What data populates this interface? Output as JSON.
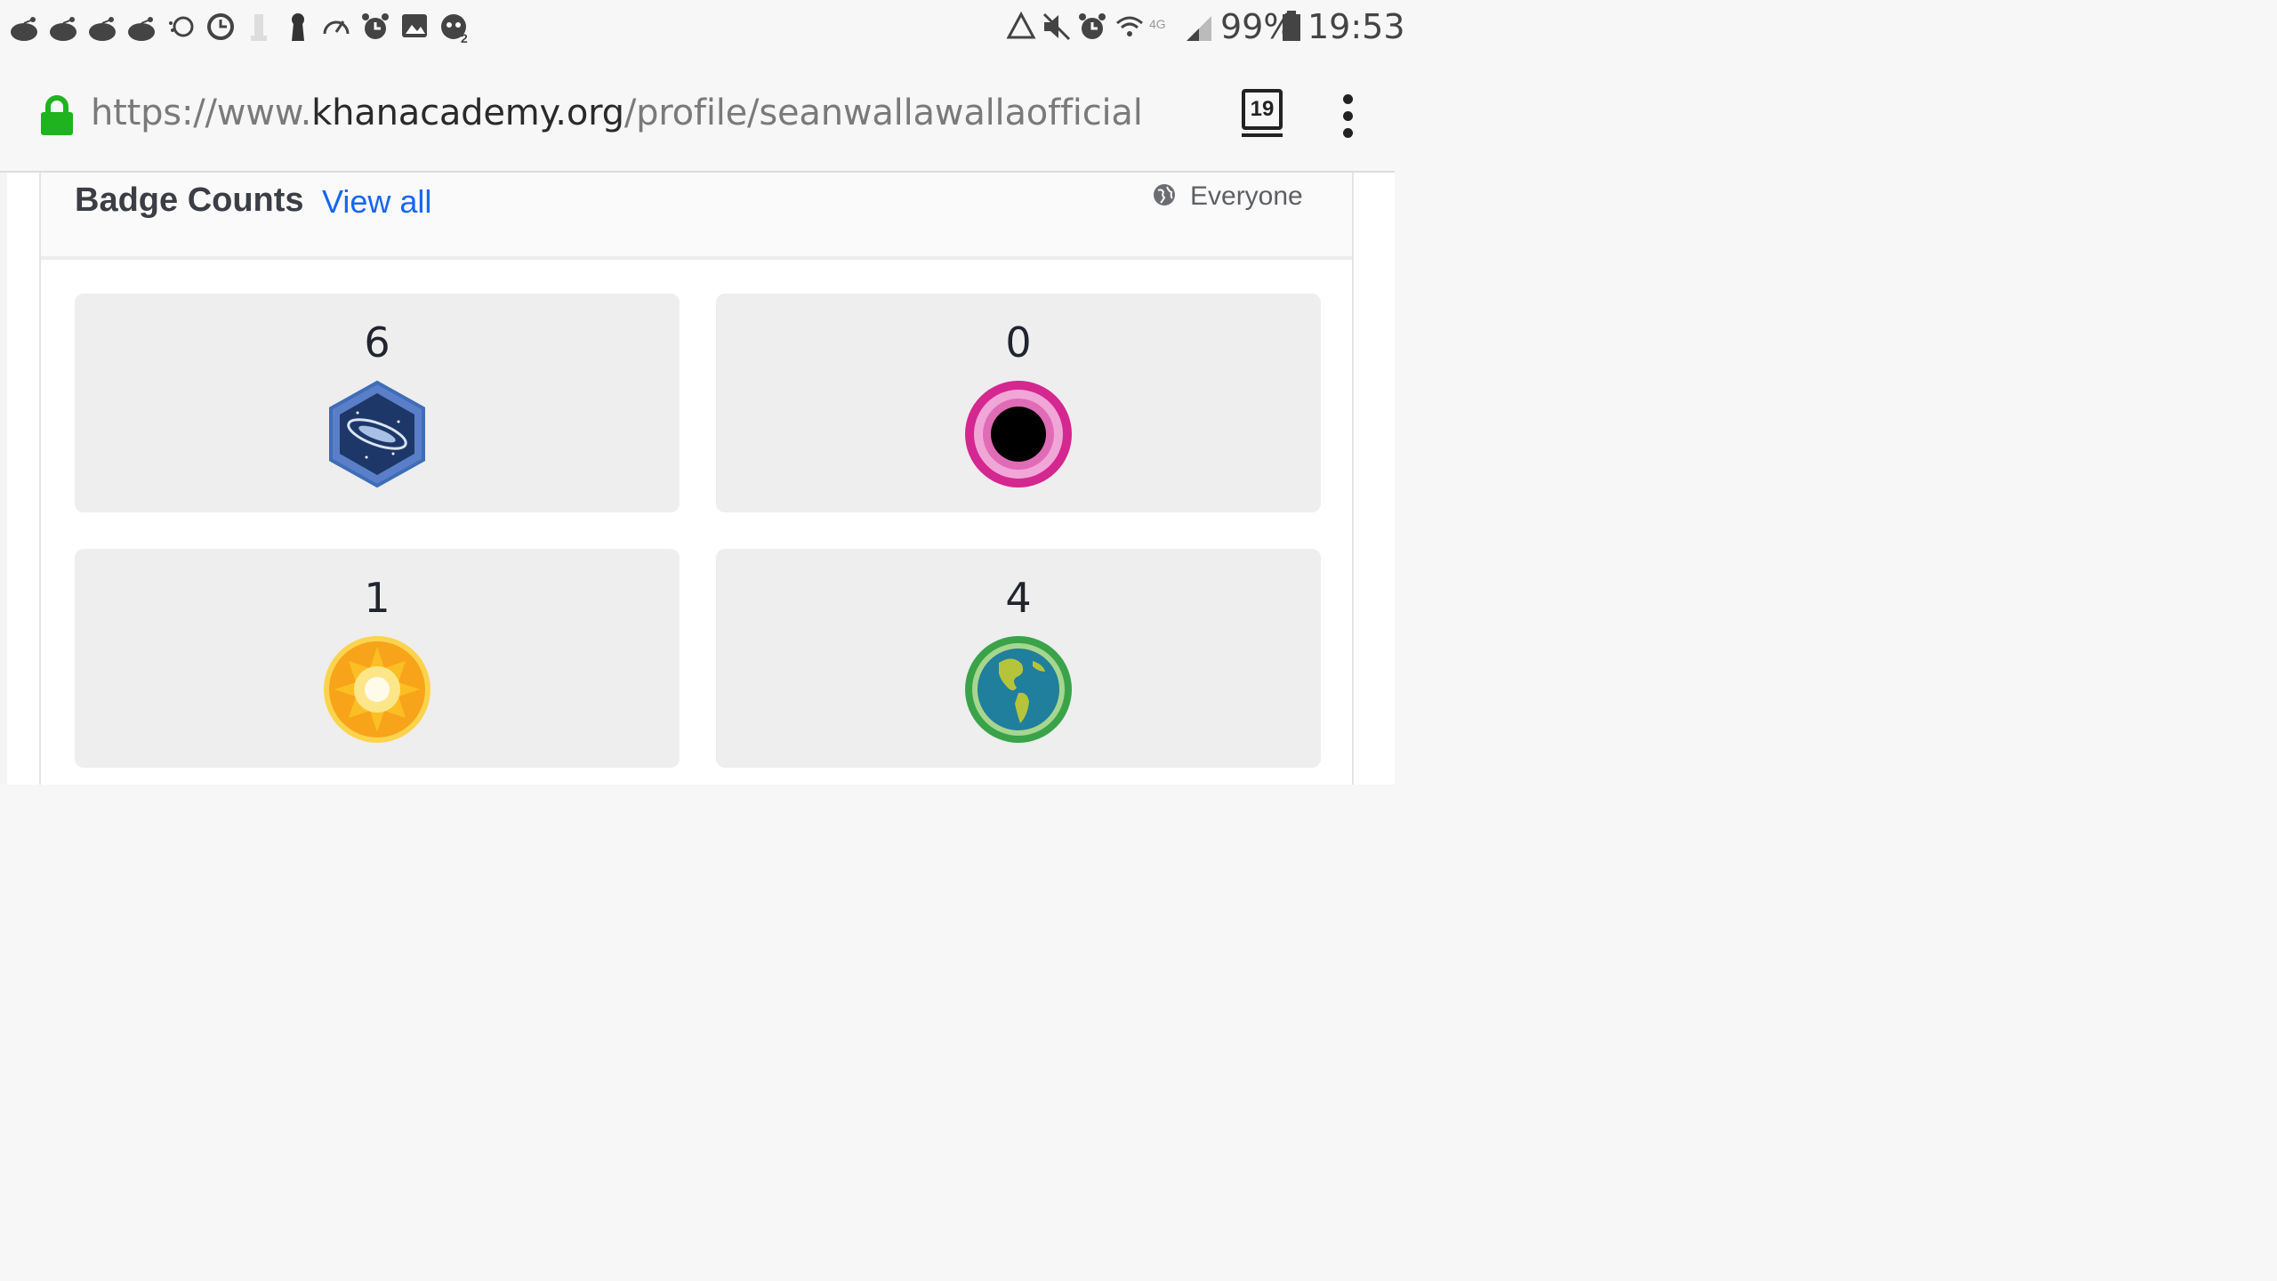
{
  "status_bar": {
    "battery_percent": "99%",
    "time": "19:53",
    "left_icons": [
      "reddit-icon",
      "reddit-icon",
      "reddit-icon",
      "reddit-icon",
      "sync-icon",
      "clock-icon",
      "chess-icon",
      "keyhole-icon",
      "speedometer-icon",
      "alarm-icon",
      "image-icon",
      "bot-icon"
    ],
    "right_icons": [
      "recycle-icon",
      "mute-icon",
      "alarm-icon",
      "wifi-icon",
      "lte-icon",
      "signal-icon",
      "battery-icon"
    ]
  },
  "browser": {
    "url_scheme": "https://www.",
    "url_domain": "khanacademy.org",
    "url_path": "/profile/seanwallawallaofficial",
    "tab_count": "19"
  },
  "badges": {
    "title": "Badge Counts",
    "view_all": "View all",
    "visibility": "Everyone",
    "items": [
      {
        "count": "6",
        "icon": "galaxy-badge-icon",
        "color": "#3f6db8"
      },
      {
        "count": "0",
        "icon": "black-hole-badge-icon",
        "color": "#d4278f"
      },
      {
        "count": "1",
        "icon": "sun-badge-icon",
        "color": "#f7a41a"
      },
      {
        "count": "4",
        "icon": "earth-badge-icon",
        "color": "#3aa34a"
      }
    ]
  }
}
